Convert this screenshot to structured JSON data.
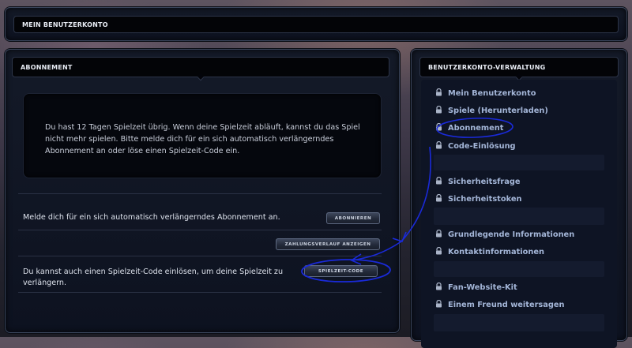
{
  "header": {
    "title": "MEIN BENUTZERKONTO"
  },
  "subscription": {
    "title": "ABONNEMENT",
    "info_text": "Du hast 12 Tagen Spielzeit übrig. Wenn deine Spielzeit abläuft, kannst du das Spiel nicht mehr spielen. Bitte melde dich für ein sich automatisch verlängerndes Abonnement an oder löse einen Spielzeit-Code ein.",
    "subscribe_text": "Melde dich für ein sich automatisch verlängerndes Abonnement an.",
    "subscribe_button": "ABONNIEREN",
    "payment_history_button": "ZAHLUNGSVERLAUF ANZEIGEN",
    "code_text": "Du kannst auch einen Spielzeit-Code einlösen, um deine Spielzeit zu verlängern.",
    "code_button": "SPIELZEIT-CODE"
  },
  "management": {
    "title": "BENUTZERKONTO-VERWALTUNG",
    "links": [
      "Mein Benutzerkonto",
      "Spiele (Herunterladen)",
      "Abonnement",
      "Code-Einlösung",
      "Sicherheitsfrage",
      "Sicherheitstoken",
      "Grundlegende Informationen",
      "Kontaktinformationen",
      "Fan-Website-Kit",
      "Einem Freund weitersagen"
    ]
  },
  "colors": {
    "link": "#a4b6d8",
    "annotation": "#1a2ad8"
  },
  "icons": {
    "nav_link": "lock-icon"
  }
}
